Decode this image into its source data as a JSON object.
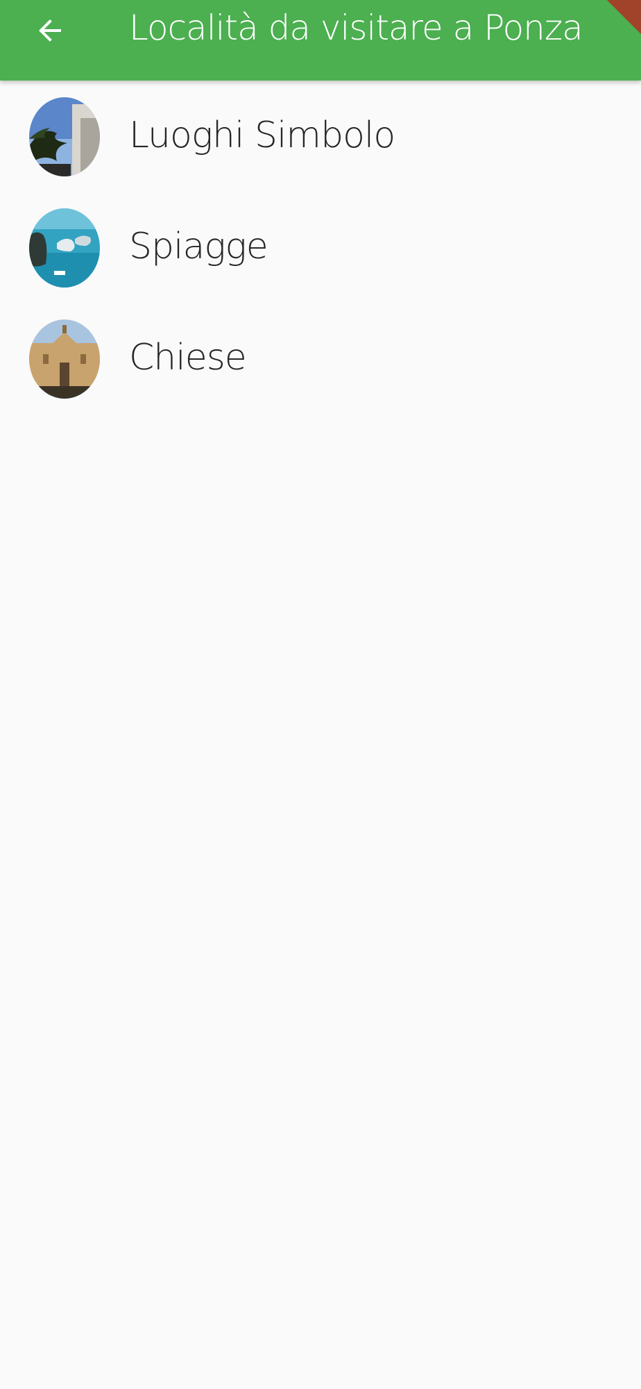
{
  "app_bar": {
    "title": "Località da visitare a Ponza",
    "back_icon": "arrow-back-icon",
    "color": "#4caf50"
  },
  "list": {
    "items": [
      {
        "label": "Luoghi Simbolo",
        "thumbnail": "landmark-thumbnail"
      },
      {
        "label": "Spiagge",
        "thumbnail": "beach-thumbnail"
      },
      {
        "label": "Chiese",
        "thumbnail": "church-thumbnail"
      }
    ]
  }
}
